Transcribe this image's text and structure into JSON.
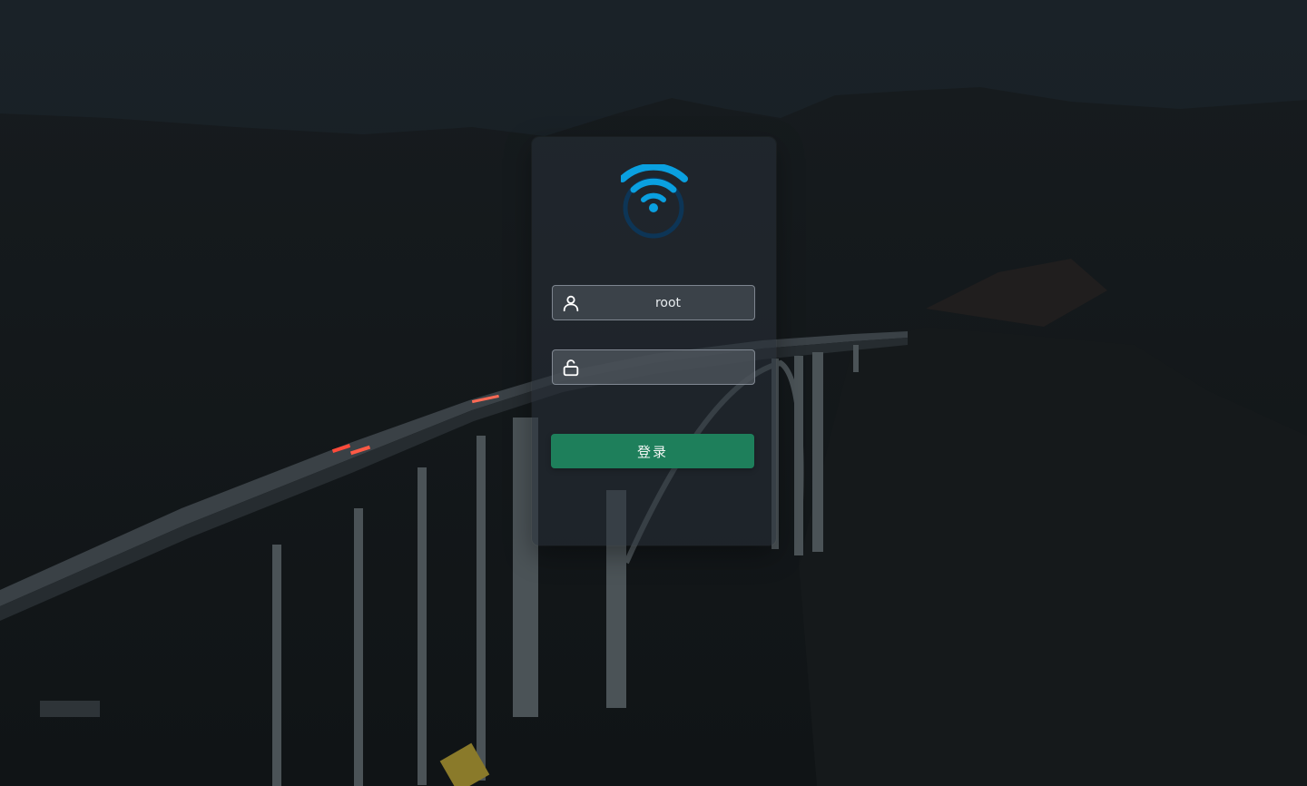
{
  "background": {
    "scene": "night-bridge-photo"
  },
  "logo": {
    "icon": "wifi-icon",
    "color": "#0aa0e0"
  },
  "username": {
    "icon": "user-icon",
    "value": "root",
    "placeholder": ""
  },
  "password": {
    "icon": "unlock-icon",
    "value": "",
    "placeholder": ""
  },
  "login_button": {
    "label": "登录",
    "color": "#1e7f5b"
  }
}
